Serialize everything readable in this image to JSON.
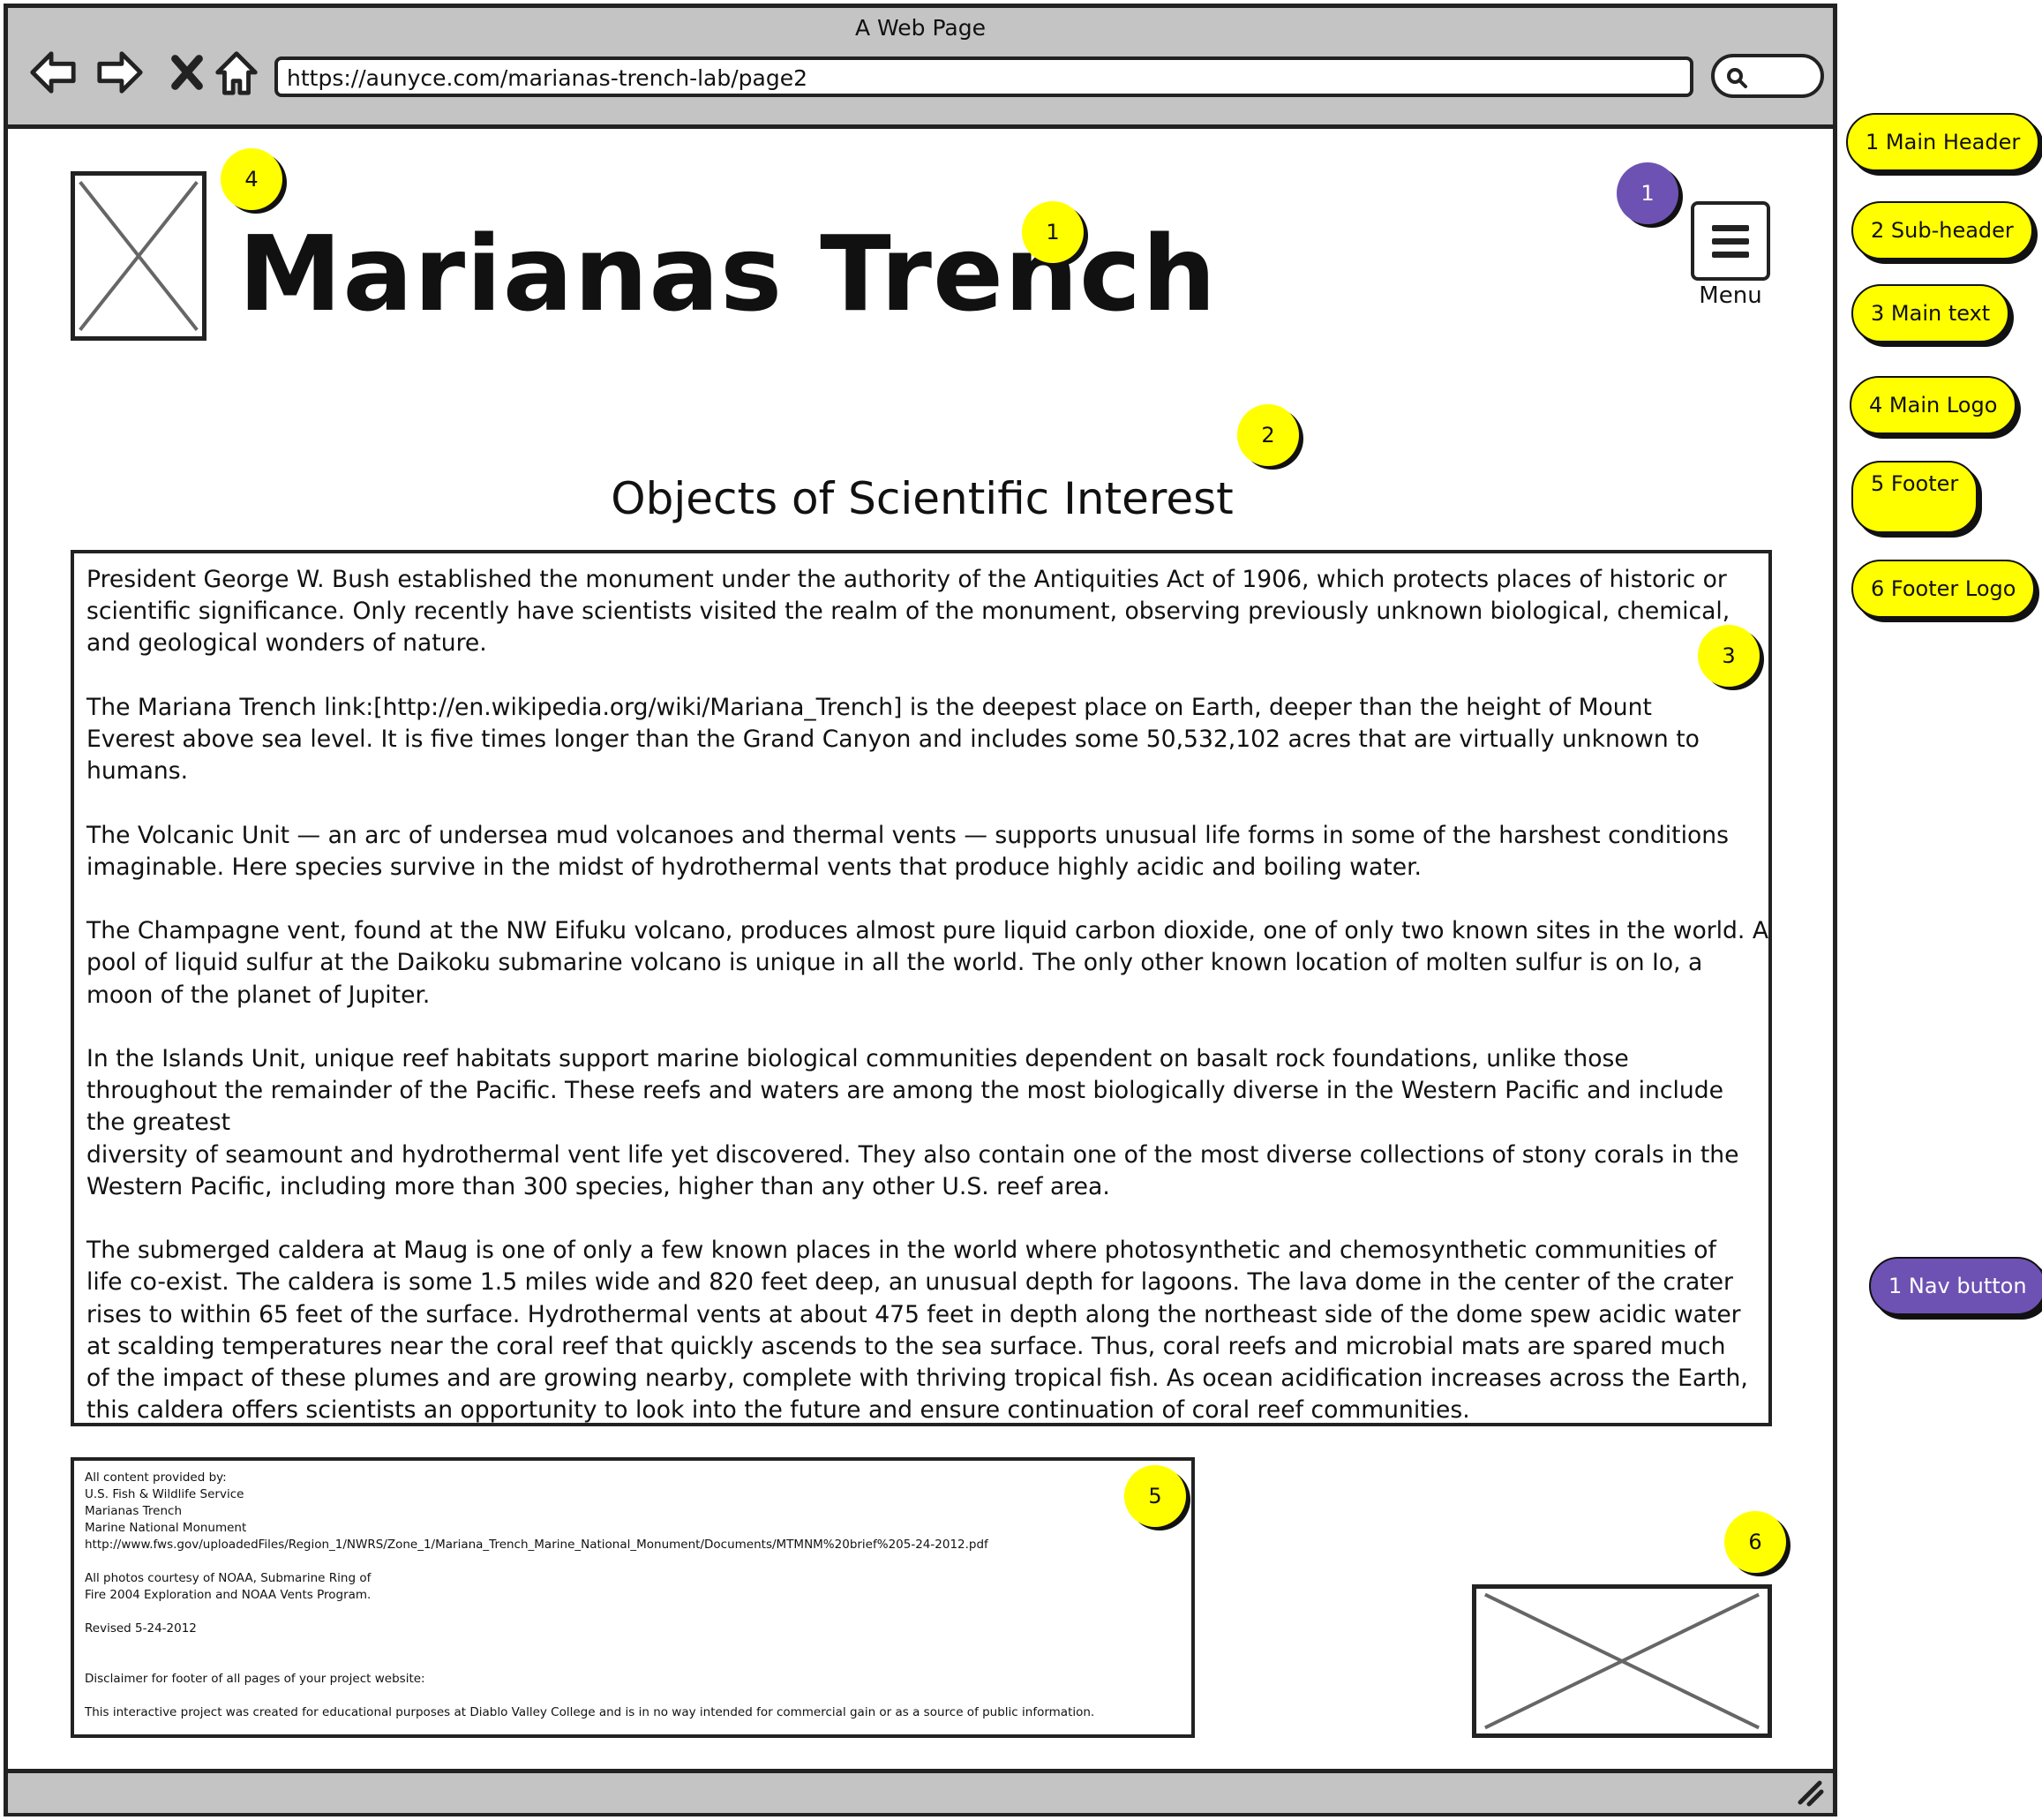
{
  "browser": {
    "window_title": "A Web Page",
    "url": "https://aunyce.com/marianas-trench-lab/page2"
  },
  "page": {
    "main_header": "Marianas Trench",
    "menu_label": "Menu",
    "sub_header": "Objects of Scientific Interest",
    "main_text": {
      "paragraphs": [
        [
          "President George W. Bush established the monument under the authority of the Antiquities Act of 1906, which protects places of historic or",
          "scientific significance. Only recently have scientists visited the realm of the monument, observing previously unknown biological, chemical,",
          "and geological wonders of nature."
        ],
        [
          "The Mariana Trench link:[http://en.wikipedia.org/wiki/Mariana_Trench] is the deepest place on Earth, deeper than the height of Mount",
          "Everest above sea level. It is five times longer than the Grand Canyon and includes some 50,532,102 acres that are virtually unknown to",
          "humans."
        ],
        [
          "The Volcanic Unit — an arc of undersea mud volcanoes and thermal vents — supports unusual life forms in some of the harshest conditions",
          "imaginable. Here species survive in the midst of hydrothermal vents that produce highly acidic and boiling water."
        ],
        [
          "The Champagne vent, found at the NW Eifuku volcano, produces almost pure liquid carbon dioxide, one of only two known sites in the world. A",
          "pool of liquid sulfur at the Daikoku submarine volcano is unique in all the world. The only other known location of molten sulfur is on Io, a",
          "moon of the planet of Jupiter."
        ],
        [
          "In the Islands Unit, unique reef habitats support marine biological communities dependent on basalt rock foundations, unlike those",
          "throughout the remainder of the Pacific. These reefs and waters are among the most biologically diverse in the Western Pacific and include",
          "the greatest",
          "diversity of seamount and hydrothermal vent life yet discovered. They also contain one of the most diverse collections of stony corals in the",
          "Western Pacific, including more than 300 species, higher than any other U.S. reef area."
        ],
        [
          "The submerged caldera at Maug is one of only a few known places in the world where photosynthetic and chemosynthetic communities of",
          "life co-exist. The caldera is some 1.5 miles wide and 820 feet deep, an unusual depth for lagoons. The lava dome in the center of the crater",
          "rises to within 65 feet of the surface. Hydrothermal vents at about 475 feet in depth along the northeast side of the dome spew acidic water",
          "at scalding temperatures near the coral reef that quickly ascends to the sea surface. Thus, coral reefs and microbial mats are spared much",
          "of the impact of these plumes and are growing nearby, complete with thriving tropical fish. As ocean acidification increases across the Earth,",
          "this caldera offers scientists an opportunity to look into the future and ensure continuation of coral reef communities."
        ]
      ]
    },
    "footer": {
      "lines": [
        "All content provided by:",
        "U.S. Fish & Wildlife Service",
        "Marianas Trench",
        "Marine National Monument",
        "http://www.fws.gov/uploadedFiles/Region_1/NWRS/Zone_1/Mariana_Trench_Marine_National_Monument/Documents/MTMNM%20brief%205-24-2012.pdf",
        "",
        "All photos courtesy of NOAA, Submarine Ring of",
        "Fire 2004 Exploration and NOAA Vents Program.",
        "",
        "Revised 5-24-2012",
        "",
        "",
        "Disclaimer for footer of all pages of your project website:",
        "",
        "This interactive project was created for educational purposes at Diablo Valley College and is in no way intended for commercial gain or as a source of public information."
      ]
    }
  },
  "annotations": {
    "markers": {
      "main_logo": "4",
      "main_header": "1",
      "nav_button": "1",
      "sub_header": "2",
      "main_text": "3",
      "footer": "5",
      "footer_logo": "6"
    },
    "legend": [
      {
        "label": "1 Main Header",
        "color": "#ffff00"
      },
      {
        "label": "2 Sub-header",
        "color": "#ffff00"
      },
      {
        "label": "3 Main text",
        "color": "#ffff00"
      },
      {
        "label": "4 Main Logo",
        "color": "#ffff00"
      },
      {
        "label": "5 Footer",
        "color": "#ffff00"
      },
      {
        "label": "6 Footer Logo",
        "color": "#ffff00"
      },
      {
        "label": "1 Nav button",
        "color": "#6d52b3"
      }
    ]
  },
  "icons": {
    "back": "back-arrow-icon",
    "forward": "forward-arrow-icon",
    "stop": "close-icon",
    "home": "home-icon",
    "search": "search-icon",
    "menu": "hamburger-menu-icon",
    "resize": "resize-grip-icon"
  },
  "colors": {
    "chrome": "#c4c4c4",
    "annotation_yellow": "#ffff00",
    "annotation_purple": "#6d52b3"
  }
}
